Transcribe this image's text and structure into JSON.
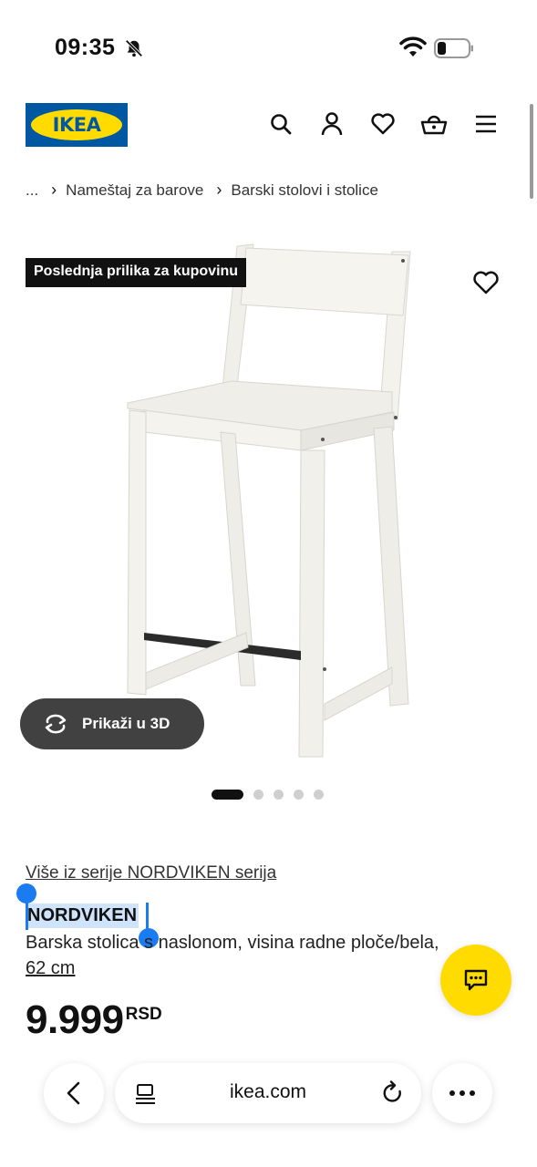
{
  "status_bar": {
    "time": "09:35",
    "icons": [
      "bell-slash-icon",
      "wifi-icon",
      "battery-icon"
    ]
  },
  "header": {
    "logo_text": "IKEA",
    "icons": [
      "search-icon",
      "user-icon",
      "heart-icon",
      "basket-icon",
      "menu-icon"
    ],
    "colors": {
      "brand_blue": "#0058a3",
      "brand_yellow": "#ffdb00"
    }
  },
  "breadcrumb": {
    "items": [
      "...",
      "Nameštaj za barove",
      "Barski stolovi i stolice"
    ]
  },
  "product_image": {
    "badge": "Poslednja prilika za kupovinu",
    "view_3d_label": "Prikaži u 3D",
    "carousel": {
      "total": 5,
      "active_index": 0
    }
  },
  "product": {
    "series_link": "Više iz serije NORDVIKEN serija",
    "name": "NORDVIKEN",
    "description": "Barska stolica s naslonom, visina radne ploče/bela,",
    "size": "62 cm",
    "price": "9.999",
    "currency": "RSD"
  },
  "chat": {
    "icon": "chat-icon",
    "color": "#ffdb00"
  },
  "browser": {
    "url": "ikea.com"
  }
}
